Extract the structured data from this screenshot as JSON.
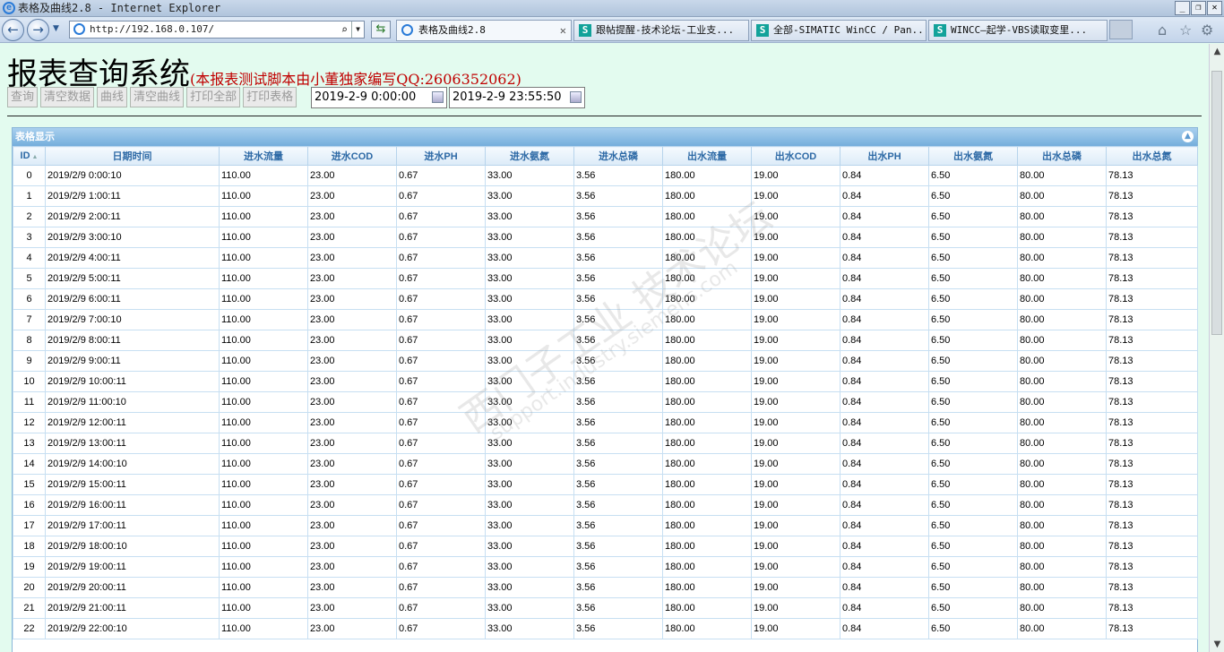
{
  "window": {
    "title": "表格及曲线2.8 - Internet Explorer"
  },
  "browser": {
    "address": "http://192.168.0.107/",
    "tabs": [
      {
        "label": "表格及曲线2.8",
        "active": true
      },
      {
        "label": "跟帖提醒-技术论坛-工业支..."
      },
      {
        "label": "全部-SIMATIC WinCC / Pan..."
      },
      {
        "label": "WINCC—起学-VBS读取变里..."
      }
    ]
  },
  "page": {
    "title": "报表查询系统",
    "subtitle": "(本报表测试脚本由小董独家编写QQ:2606352062)",
    "buttons": [
      "查询",
      "清空数据",
      "曲线",
      "清空曲线",
      "打印全部",
      "打印表格"
    ],
    "start_time": "2019-2-9 0:00:00",
    "end_time": "2019-2-9 23:55:50"
  },
  "grid": {
    "caption": "表格显示",
    "sort_indicator": "▲",
    "columns": [
      "ID",
      "日期时间",
      "进水流量",
      "进水COD",
      "进水PH",
      "进水氨氮",
      "进水总磷",
      "出水流量",
      "出水COD",
      "出水PH",
      "出水氨氮",
      "出水总磷",
      "出水总氮"
    ],
    "rows": [
      [
        "0",
        "2019/2/9 0:00:10",
        "110.00",
        "23.00",
        "0.67",
        "33.00",
        "3.56",
        "180.00",
        "19.00",
        "0.84",
        "6.50",
        "80.00",
        "78.13"
      ],
      [
        "1",
        "2019/2/9 1:00:11",
        "110.00",
        "23.00",
        "0.67",
        "33.00",
        "3.56",
        "180.00",
        "19.00",
        "0.84",
        "6.50",
        "80.00",
        "78.13"
      ],
      [
        "2",
        "2019/2/9 2:00:11",
        "110.00",
        "23.00",
        "0.67",
        "33.00",
        "3.56",
        "180.00",
        "19.00",
        "0.84",
        "6.50",
        "80.00",
        "78.13"
      ],
      [
        "3",
        "2019/2/9 3:00:10",
        "110.00",
        "23.00",
        "0.67",
        "33.00",
        "3.56",
        "180.00",
        "19.00",
        "0.84",
        "6.50",
        "80.00",
        "78.13"
      ],
      [
        "4",
        "2019/2/9 4:00:11",
        "110.00",
        "23.00",
        "0.67",
        "33.00",
        "3.56",
        "180.00",
        "19.00",
        "0.84",
        "6.50",
        "80.00",
        "78.13"
      ],
      [
        "5",
        "2019/2/9 5:00:11",
        "110.00",
        "23.00",
        "0.67",
        "33.00",
        "3.56",
        "180.00",
        "19.00",
        "0.84",
        "6.50",
        "80.00",
        "78.13"
      ],
      [
        "6",
        "2019/2/9 6:00:11",
        "110.00",
        "23.00",
        "0.67",
        "33.00",
        "3.56",
        "180.00",
        "19.00",
        "0.84",
        "6.50",
        "80.00",
        "78.13"
      ],
      [
        "7",
        "2019/2/9 7:00:10",
        "110.00",
        "23.00",
        "0.67",
        "33.00",
        "3.56",
        "180.00",
        "19.00",
        "0.84",
        "6.50",
        "80.00",
        "78.13"
      ],
      [
        "8",
        "2019/2/9 8:00:11",
        "110.00",
        "23.00",
        "0.67",
        "33.00",
        "3.56",
        "180.00",
        "19.00",
        "0.84",
        "6.50",
        "80.00",
        "78.13"
      ],
      [
        "9",
        "2019/2/9 9:00:11",
        "110.00",
        "23.00",
        "0.67",
        "33.00",
        "3.56",
        "180.00",
        "19.00",
        "0.84",
        "6.50",
        "80.00",
        "78.13"
      ],
      [
        "10",
        "2019/2/9 10:00:11",
        "110.00",
        "23.00",
        "0.67",
        "33.00",
        "3.56",
        "180.00",
        "19.00",
        "0.84",
        "6.50",
        "80.00",
        "78.13"
      ],
      [
        "11",
        "2019/2/9 11:00:10",
        "110.00",
        "23.00",
        "0.67",
        "33.00",
        "3.56",
        "180.00",
        "19.00",
        "0.84",
        "6.50",
        "80.00",
        "78.13"
      ],
      [
        "12",
        "2019/2/9 12:00:11",
        "110.00",
        "23.00",
        "0.67",
        "33.00",
        "3.56",
        "180.00",
        "19.00",
        "0.84",
        "6.50",
        "80.00",
        "78.13"
      ],
      [
        "13",
        "2019/2/9 13:00:11",
        "110.00",
        "23.00",
        "0.67",
        "33.00",
        "3.56",
        "180.00",
        "19.00",
        "0.84",
        "6.50",
        "80.00",
        "78.13"
      ],
      [
        "14",
        "2019/2/9 14:00:10",
        "110.00",
        "23.00",
        "0.67",
        "33.00",
        "3.56",
        "180.00",
        "19.00",
        "0.84",
        "6.50",
        "80.00",
        "78.13"
      ],
      [
        "15",
        "2019/2/9 15:00:11",
        "110.00",
        "23.00",
        "0.67",
        "33.00",
        "3.56",
        "180.00",
        "19.00",
        "0.84",
        "6.50",
        "80.00",
        "78.13"
      ],
      [
        "16",
        "2019/2/9 16:00:11",
        "110.00",
        "23.00",
        "0.67",
        "33.00",
        "3.56",
        "180.00",
        "19.00",
        "0.84",
        "6.50",
        "80.00",
        "78.13"
      ],
      [
        "17",
        "2019/2/9 17:00:11",
        "110.00",
        "23.00",
        "0.67",
        "33.00",
        "3.56",
        "180.00",
        "19.00",
        "0.84",
        "6.50",
        "80.00",
        "78.13"
      ],
      [
        "18",
        "2019/2/9 18:00:10",
        "110.00",
        "23.00",
        "0.67",
        "33.00",
        "3.56",
        "180.00",
        "19.00",
        "0.84",
        "6.50",
        "80.00",
        "78.13"
      ],
      [
        "19",
        "2019/2/9 19:00:11",
        "110.00",
        "23.00",
        "0.67",
        "33.00",
        "3.56",
        "180.00",
        "19.00",
        "0.84",
        "6.50",
        "80.00",
        "78.13"
      ],
      [
        "20",
        "2019/2/9 20:00:11",
        "110.00",
        "23.00",
        "0.67",
        "33.00",
        "3.56",
        "180.00",
        "19.00",
        "0.84",
        "6.50",
        "80.00",
        "78.13"
      ],
      [
        "21",
        "2019/2/9 21:00:11",
        "110.00",
        "23.00",
        "0.67",
        "33.00",
        "3.56",
        "180.00",
        "19.00",
        "0.84",
        "6.50",
        "80.00",
        "78.13"
      ],
      [
        "22",
        "2019/2/9 22:00:10",
        "110.00",
        "23.00",
        "0.67",
        "33.00",
        "3.56",
        "180.00",
        "19.00",
        "0.84",
        "6.50",
        "80.00",
        "78.13"
      ]
    ]
  },
  "watermark": {
    "line1": "西门子工业 技术论坛",
    "line2": "support.industry.siemens.com"
  }
}
